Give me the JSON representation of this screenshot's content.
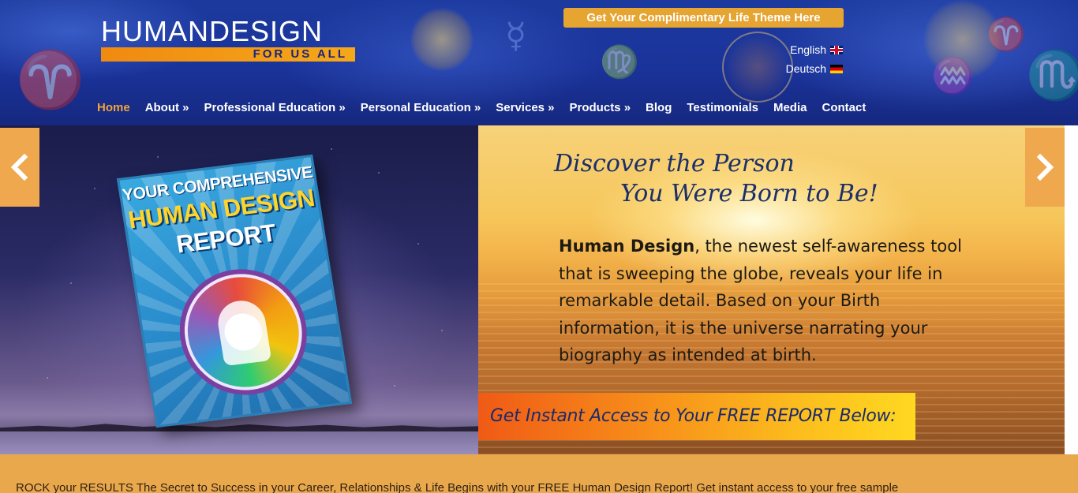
{
  "header": {
    "logo": {
      "main": "HUMANDESIGN",
      "sub": "FOR US ALL"
    },
    "cta_label": "Get Your Complimentary Life Theme Here",
    "languages": [
      {
        "label": "English",
        "flag": "uk-flag-icon"
      },
      {
        "label": "Deutsch",
        "flag": "de-flag-icon"
      }
    ],
    "nav": [
      {
        "label": "Home",
        "active": true
      },
      {
        "label": "About »"
      },
      {
        "label": "Professional Education »"
      },
      {
        "label": "Personal Education »"
      },
      {
        "label": "Services »"
      },
      {
        "label": "Products »"
      },
      {
        "label": "Blog"
      },
      {
        "label": "Testimonials"
      },
      {
        "label": "Media"
      },
      {
        "label": "Contact"
      }
    ]
  },
  "slider": {
    "report": {
      "line1": "YOUR COMPREHENSIVE",
      "line2": "HUMAN DESIGN",
      "line3": "REPORT"
    },
    "headline_1": "Discover the Person",
    "headline_2": "You Were Born to Be!",
    "body_bold": "Human Design",
    "body_rest": ", the newest self-awareness tool that is sweeping the globe, reveals your life in remarkable detail. Based on your Birth information, it is the universe narrating your biography as intended at birth.",
    "cta": "Get Instant Access to Your FREE REPORT Below:",
    "prev_icon": "chevron-left-icon",
    "next_icon": "chevron-right-icon"
  },
  "band": {
    "text": "ROCK your RESULTS The Secret to Success in your Career, Relationships & Life Begins with your FREE Human Design Report! Get instant access to your free sample"
  },
  "colors": {
    "header_blue": "#1a339a",
    "accent_orange": "#e6a431",
    "nav_active": "#f0a43a",
    "band": "#eaa84c",
    "headline_navy": "#1b2f6a"
  }
}
